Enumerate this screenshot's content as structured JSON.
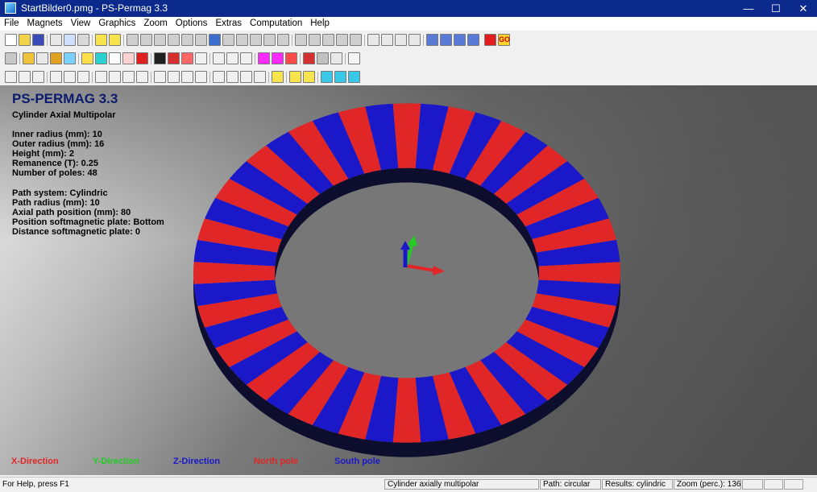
{
  "window": {
    "title": "StartBilder0.pmg - PS-Permag 3.3",
    "minimize": "—",
    "maximize": "☐",
    "close": "✕"
  },
  "menu": [
    "File",
    "Magnets",
    "View",
    "Graphics",
    "Zoom",
    "Options",
    "Extras",
    "Computation",
    "Help"
  ],
  "toolbar": {
    "go_label": "GO"
  },
  "overlay": {
    "app_name": "PS-PERMAG 3.3",
    "magnet_type": "Cylinder Axial Multipolar",
    "params": [
      "Inner radius (mm): 10",
      "Outer radius (mm): 16",
      "Height (mm): 2",
      "Remanence (T): 0.25",
      "Number of poles: 48"
    ],
    "path": [
      "Path system: Cylindric",
      "Path radius (mm): 10",
      "Axial path position (mm): 80",
      "Position softmagnetic plate: Bottom",
      "Distance softmagnetic plate: 0"
    ],
    "legend": {
      "x": "X-Direction",
      "y": "Y-Direction",
      "z": "Z-Direction",
      "north": "North pole",
      "south": "South pole"
    }
  },
  "magnet": {
    "poles": 48,
    "north_color": "#e02626",
    "south_color": "#1a18c8"
  },
  "status": {
    "help": "For Help, press F1",
    "magnet": "Cylinder axially multipolar",
    "path": "Path: circular",
    "results": "Results: cylindric",
    "zoom": "Zoom (perc.): 136"
  }
}
